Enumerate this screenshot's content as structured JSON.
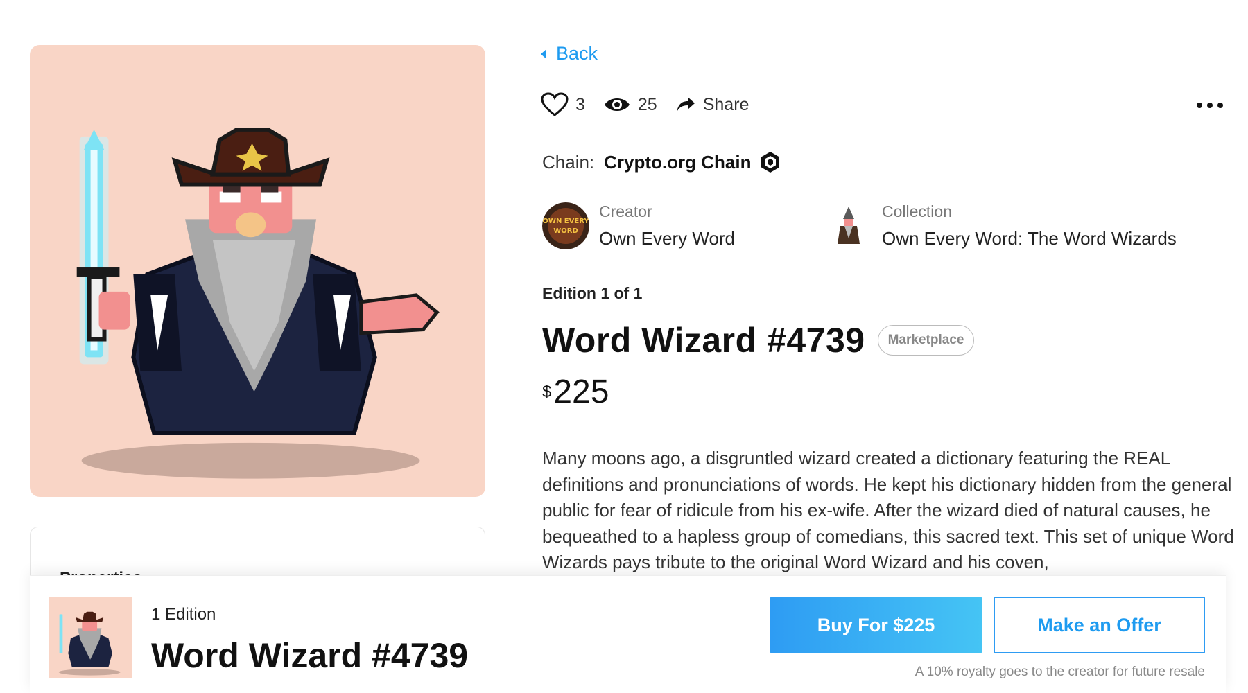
{
  "nav": {
    "back_label": "Back"
  },
  "stats": {
    "likes": "3",
    "views": "25",
    "share_label": "Share"
  },
  "chain": {
    "label": "Chain:",
    "name": "Crypto.org Chain"
  },
  "creator": {
    "label": "Creator",
    "name": "Own Every Word",
    "avatar_text": "OWN EVERY WORD"
  },
  "collection": {
    "label": "Collection",
    "name": "Own Every Word: The Word Wizards"
  },
  "edition": "Edition 1 of 1",
  "title": "Word Wizard #4739",
  "badge": "Marketplace",
  "price": {
    "currency": "$",
    "value": "225"
  },
  "description": "Many moons ago, a disgruntled wizard created a dictionary featuring the REAL definitions and pronunciations of words. He kept his dictionary hidden from the general public for fear of ridicule from his ex-wife. After the wizard died of natural causes, he bequeathed to a hapless group of comedians, this sacred text. This set of unique Word Wizards pays tribute to the original Word Wizard and his coven,",
  "properties": {
    "title": "Properties"
  },
  "bottom_bar": {
    "edition_count": "1 Edition",
    "title": "Word Wizard #4739",
    "buy_label": "Buy For $225",
    "offer_label": "Make an Offer",
    "royalty_note": "A 10% royalty goes to the creator for future resale"
  },
  "colors": {
    "accent": "#1e9bf0",
    "artwork_background": "#f9d5c6",
    "robe": "#1c2340",
    "beard": "#a8a8a8",
    "hat": "#4a1e12",
    "sword": "#7ee3f5"
  }
}
